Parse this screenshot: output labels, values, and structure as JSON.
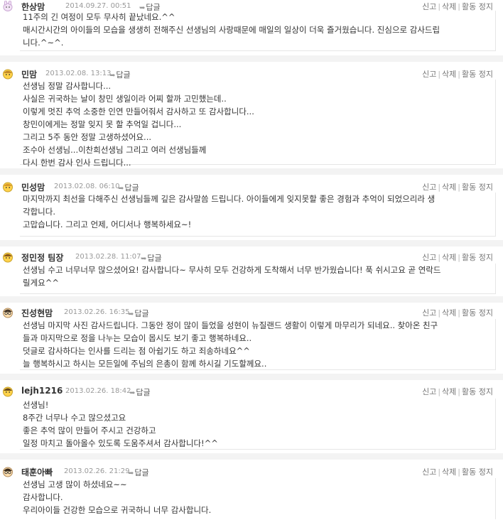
{
  "actions": {
    "report": "신고",
    "delete": "삭제",
    "block": "활동 정지",
    "reply": "답글"
  },
  "comments": [
    {
      "nick": "한상맘",
      "date": "2014.09.27. 00:51",
      "lines": [
        "11주의 긴 여정이 모두 무사히 끝났네요.^^",
        "매시간시간의 아이들의 모습을 생생히 전해주신 선생님의 사랑때문에 매일의 일상이 더욱 즐거웠습니다. 진심으로 감사드립",
        "니다.^~^."
      ]
    },
    {
      "nick": "민맘",
      "date": "2013.02.08. 13:13",
      "lines": [
        "선생님 정말 감사합니다...",
        "사실은 귀국하는 날이 창민 생일이라 어찌 할까 고민했는데..",
        "이렇게 멋진 추억 소중한 인연 만들어줘서 감사하고 또 감사합니다...",
        "창민이에게는 정말 잊지 못 할 추억일 겁니다...",
        "그리고 5주 동안 정말 고생하셨어요...",
        "조수아 선생님...이찬희선생님 그리고 여러 선생님들께",
        "다시 한번 감사 인사 드립니다..."
      ]
    },
    {
      "nick": "민성맘",
      "date": "2013.02.08. 06:10",
      "lines": [
        "마지막까지 최선을 다해주신 선생님들께 깊은 감사말씀 드립니다. 아이들에게 잊지못할 좋은 경험과 추억이 되었으리라 생",
        "각합니다.",
        "고맙습니다. 그리고 언제, 어디서나 행복하세요~!"
      ]
    },
    {
      "nick": "정민정 팀장",
      "date": "2013.02.28. 11:07",
      "lines": [
        "선생님 수고 너무너무 많으셨어요! 감사합니다~ 무사히 모두 건강하게 도착해서 너무 반가웠습니다! 푹 쉬시고요 곧 연락드",
        "릴게요^^"
      ]
    },
    {
      "nick": "진성현맘",
      "date": "2013.02.26. 16:35",
      "lines": [
        "선생님 마지막 사진 감사드립니다. 그동안 정이 많이 들었을 성현이 뉴질랜드 생활이 이렇게 마무리가 되네요.. 찾아온 친구",
        "들과 마지막으로 정을 나누는 모습이 몹시도 보기 좋고 행복하네요..",
        "덧글로 감사하다는 인사를 드리는 점 아쉽기도 하고 죄송하네요^^",
        "늘 행복하시고 하시는 모든일에 주님의 은총이 함께 하시길 기도할께요.."
      ]
    },
    {
      "nick": "lejh1216",
      "date": "2013.02.26. 18:42",
      "lines": [
        "선생님!",
        "8주간 너무나 수고 많으셨고요",
        "좋은 추억 많이 만들어 주시고 건강하고",
        "일정 마치고 돌아올수 있도록 도움주셔서 감사합니다!^^"
      ]
    },
    {
      "nick": "태훈아빠",
      "date": "2013.02.26. 21:29",
      "lines": [
        "선생님 고생 많이 하셨네요~~",
        "감사합니다.",
        "우리아이들 건강한 모습으로 귀국하니 너무 감사합니다."
      ]
    }
  ]
}
